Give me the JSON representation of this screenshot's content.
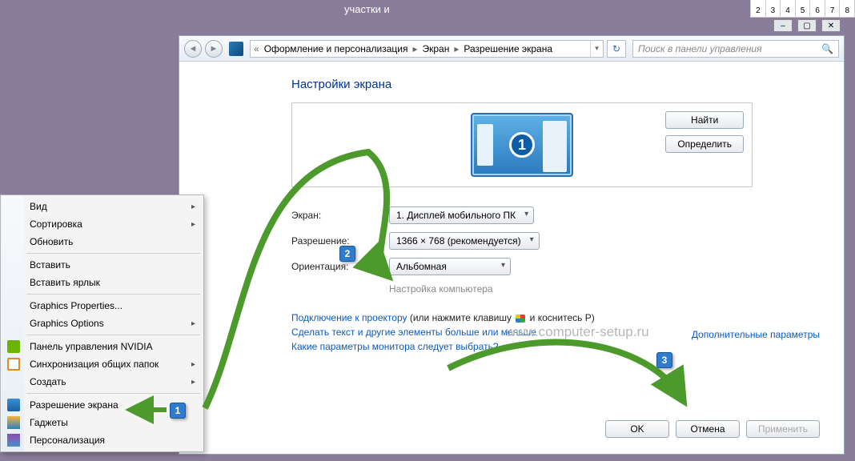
{
  "desktop_title": "участки и",
  "num_strip": [
    "2",
    "3",
    "4",
    "5",
    "6",
    "7",
    "8"
  ],
  "breadcrumb": {
    "item1": "Оформление и персонализация",
    "item2": "Экран",
    "item3": "Разрешение экрана"
  },
  "search_placeholder": "Поиск в панели управления",
  "page_title": "Настройки экрана",
  "buttons": {
    "find": "Найти",
    "detect": "Определить",
    "ok": "OK",
    "cancel": "Отмена",
    "apply": "Применить"
  },
  "display_number": "1",
  "fields": {
    "screen_label": "Экран:",
    "screen_value": "1. Дисплей мобильного ПК",
    "resolution_label": "Разрешение:",
    "resolution_value": "1366 × 768 (рекомендуется)",
    "orientation_label": "Ориентация:",
    "orientation_value": "Альбомная"
  },
  "gray_note": "Настройка компьютера",
  "watermark": "www.computer-setup.ru",
  "adv_link": "Дополнительные параметры",
  "links": {
    "projector_a": "Подключение к проектору",
    "projector_b": " (или нажмите клавишу ",
    "projector_c": " и коснитесь P)",
    "bigger_text": "Сделать текст и другие элементы больше или меньше",
    "monitor_q": "Какие параметры монитора следует выбрать?"
  },
  "context_menu": {
    "view": "Вид",
    "sort": "Сортировка",
    "refresh": "Обновить",
    "paste": "Вставить",
    "paste_shortcut": "Вставить ярлык",
    "gfx_props": "Graphics Properties...",
    "gfx_opts": "Graphics Options",
    "nvidia": "Панель управления NVIDIA",
    "sync": "Синхронизация общих папок",
    "create": "Создать",
    "screen_res": "Разрешение экрана",
    "gadgets": "Гаджеты",
    "personalize": "Персонализация"
  },
  "callouts": {
    "c1": "1",
    "c2": "2",
    "c3": "3"
  }
}
